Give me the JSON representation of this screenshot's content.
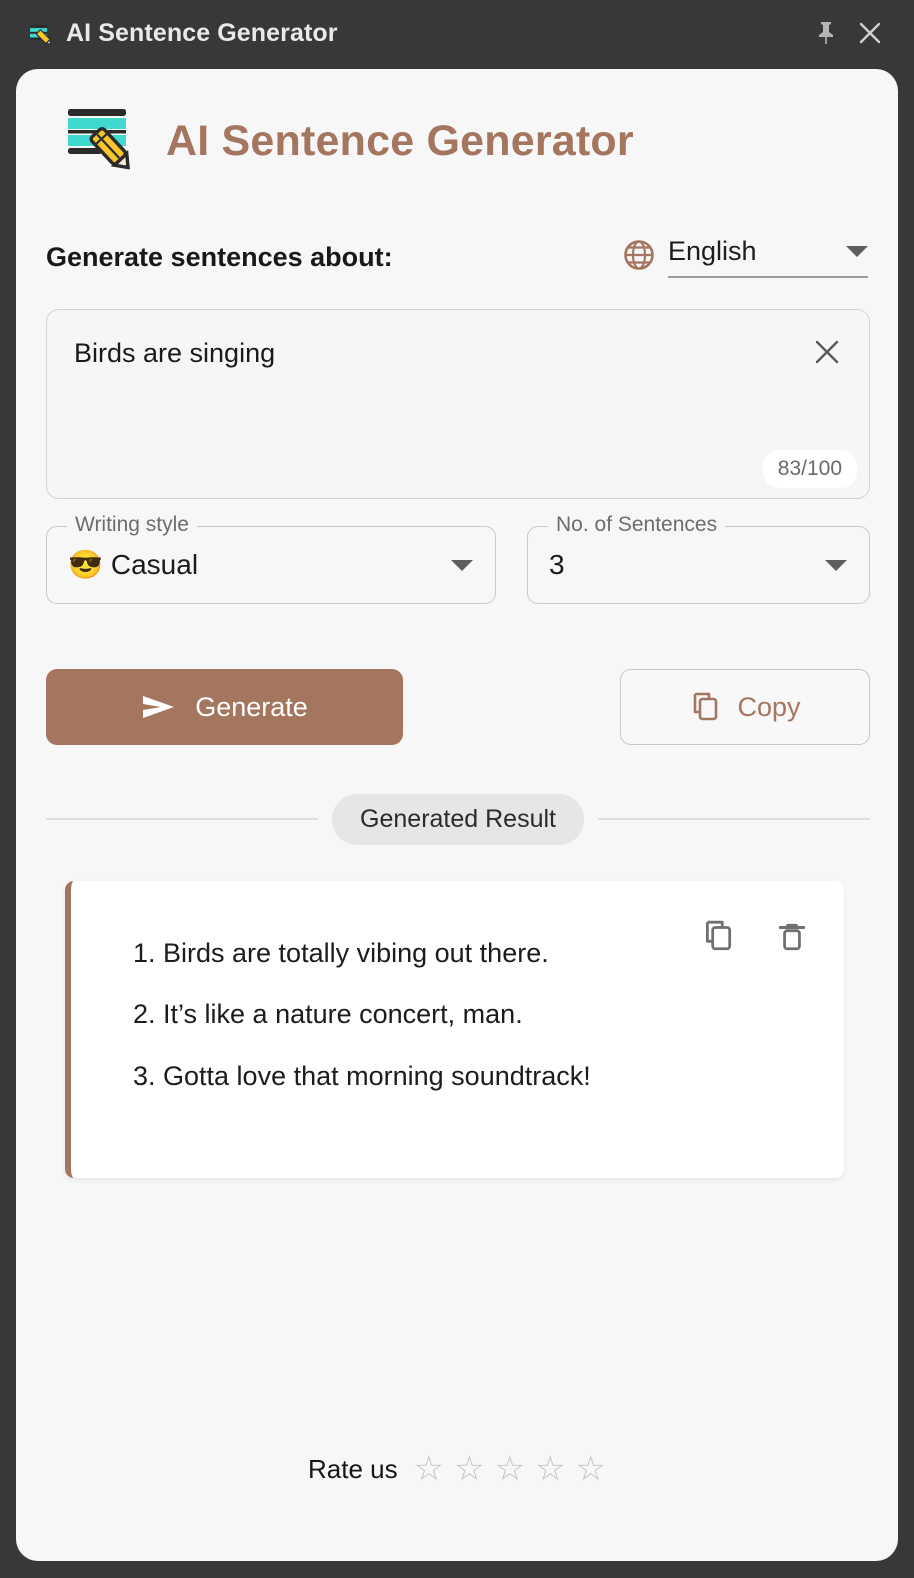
{
  "window": {
    "title": "AI Sentence Generator",
    "app_icon": "note-pencil-icon",
    "pin_icon": "pin-icon",
    "close_icon": "close-icon",
    "titlebar_bg": "#383838"
  },
  "brand": {
    "logo_icon": "note-pencil-logo-icon",
    "title": "AI Sentence Generator",
    "accent_color": "#a5765f"
  },
  "prompt": {
    "label": "Generate sentences about:",
    "language_icon": "globe-icon",
    "language_value": "English",
    "language_caret_icon": "chevron-down-icon"
  },
  "input": {
    "value": "Birds are singing",
    "placeholder": "Generate sentences about:",
    "clear_icon": "close-icon",
    "counter": "83/100"
  },
  "options": {
    "style": {
      "legend": "Writing style",
      "emoji": "😎",
      "emoji_name": "sunglasses-emoji",
      "value": "Casual",
      "caret_icon": "chevron-down-icon"
    },
    "count": {
      "legend": "No. of Sentences",
      "value": "3",
      "caret_icon": "chevron-down-icon"
    }
  },
  "actions": {
    "generate_label": "Generate",
    "generate_icon": "send-icon",
    "copy_label": "Copy",
    "copy_icon": "copy-icon"
  },
  "divider": {
    "chip_label": "Generated Result"
  },
  "result": {
    "copy_icon": "copy-icon",
    "delete_icon": "trash-icon",
    "lines": [
      "1. Birds are totally vibing out there.",
      "2. It’s like a nature concert, man.",
      "3. Gotta love that morning soundtrack!"
    ]
  },
  "footer": {
    "rate_label": "Rate us",
    "stars": [
      "☆",
      "☆",
      "☆",
      "☆",
      "☆"
    ],
    "star_filled_count": 0
  }
}
